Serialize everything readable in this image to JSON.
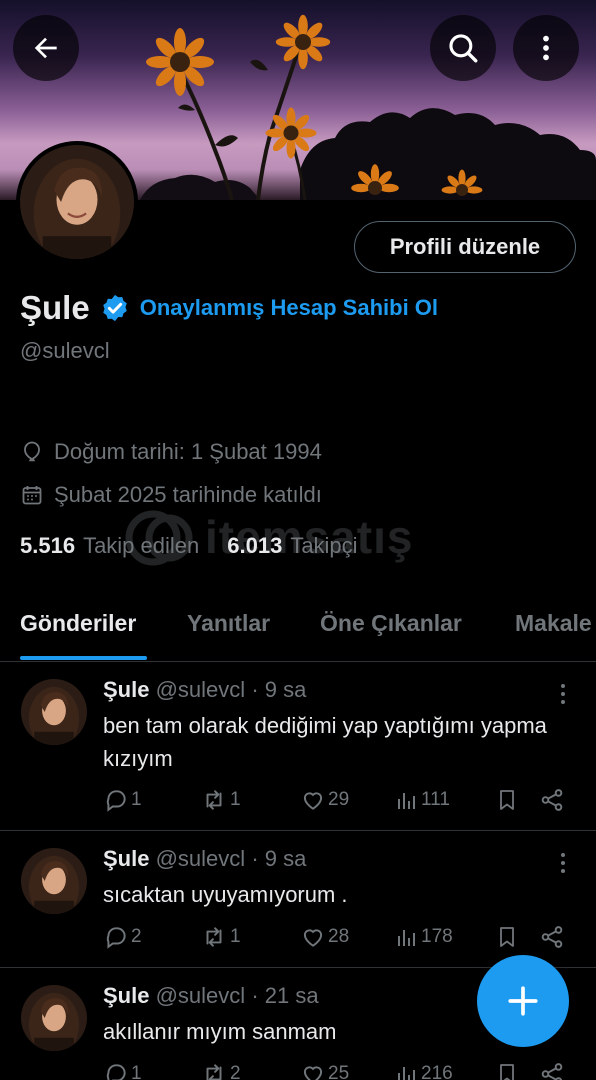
{
  "header": {
    "back_icon": "arrow-left-icon",
    "search_icon": "search-icon",
    "more_icon": "more-vertical-icon"
  },
  "profile": {
    "edit_button": "Profili düzenle",
    "name": "Şule",
    "verify_link": "Onaylanmış Hesap Sahibi Ol",
    "handle": "@sulevcl",
    "birth": "Doğum tarihi: 1 Şubat 1994",
    "joined": "Şubat 2025 tarihinde katıldı",
    "following_count": "5.516",
    "following_label": "Takip edilen",
    "followers_count": "6.013",
    "followers_label": "Takipçi"
  },
  "watermark": "itemsatış",
  "tabs": [
    {
      "label": "Gönderiler",
      "active": true
    },
    {
      "label": "Yanıtlar",
      "active": false
    },
    {
      "label": "Öne Çıkanlar",
      "active": false
    },
    {
      "label": "Makale",
      "active": false
    }
  ],
  "tweets": [
    {
      "name": "Şule",
      "handle": "@sulevcl",
      "time": "9 sa",
      "text": "ben tam olarak dediğimi yap yaptığımı yapma kızıyım",
      "replies": "1",
      "retweets": "1",
      "likes": "29",
      "views": "111"
    },
    {
      "name": "Şule",
      "handle": "@sulevcl",
      "time": "9 sa",
      "text": "sıcaktan uyuyamıyorum .",
      "replies": "2",
      "retweets": "1",
      "likes": "28",
      "views": "178"
    },
    {
      "name": "Şule",
      "handle": "@sulevcl",
      "time": "21 sa",
      "text": "akıllanır mıyım sanmam",
      "replies": "1",
      "retweets": "2",
      "likes": "25",
      "views": "216"
    }
  ],
  "colors": {
    "accent": "#1d9bf0",
    "background": "#000000",
    "text": "#e7e9ea",
    "muted": "#71767b",
    "divider": "#2f3336"
  },
  "fab_icon": "plus-icon"
}
